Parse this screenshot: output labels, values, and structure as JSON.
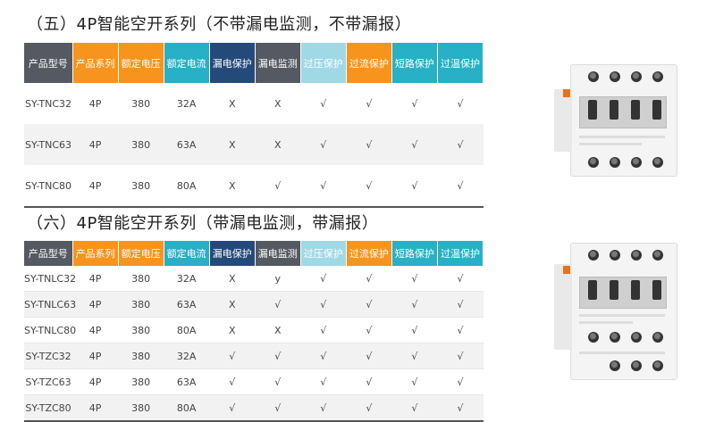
{
  "section1": {
    "title": "（五）4P智能空开系列（不带漏电监测，不带漏报）"
  },
  "section2": {
    "title": "（六）4P智能空开系列（带漏电监测，带漏报）"
  },
  "header_colors": [
    "#555961",
    "#f7941d",
    "#f7941d",
    "#27b0c6",
    "#244a7a",
    "#555961",
    "#9fd9e6",
    "#f7941d",
    "#27b0c6",
    "#27b0c6"
  ],
  "headers": [
    "产品型号",
    "产品系列",
    "额定电压",
    "额定电流",
    "漏电保护",
    "漏电监测",
    "过压保护",
    "过流保护",
    "短路保护",
    "过温保护"
  ],
  "table1": {
    "rows": [
      [
        "SY-TNC32",
        "4P",
        "380",
        "32A",
        "X",
        "X",
        "√",
        "√",
        "√",
        "√"
      ],
      [
        "SY-TNC63",
        "4P",
        "380",
        "63A",
        "X",
        "X",
        "√",
        "√",
        "√",
        "√"
      ],
      [
        "SY-TNC80",
        "4P",
        "380",
        "80A",
        "X",
        "√",
        "√",
        "√",
        "√",
        "√"
      ]
    ]
  },
  "table2": {
    "rows": [
      [
        "SY-TNLC32",
        "4P",
        "380",
        "32A",
        "X",
        "y",
        "√",
        "√",
        "√",
        "√"
      ],
      [
        "SY-TNLC63",
        "4P",
        "380",
        "63A",
        "X",
        "√",
        "√",
        "√",
        "√",
        "√"
      ],
      [
        "SY-TNLC80",
        "4P",
        "380",
        "80A",
        "X",
        "X",
        "√",
        "√",
        "√",
        "√"
      ],
      [
        "SY-TZC32",
        "4P",
        "380",
        "32A",
        "√",
        "√",
        "√",
        "√",
        "√",
        "√"
      ],
      [
        "SY-TZC63",
        "4P",
        "380",
        "63A",
        "√",
        "√",
        "√",
        "√",
        "√",
        "√"
      ],
      [
        "SY-TZC80",
        "4P",
        "380",
        "80A",
        "√",
        "√",
        "√",
        "√",
        "√",
        "√"
      ]
    ]
  }
}
